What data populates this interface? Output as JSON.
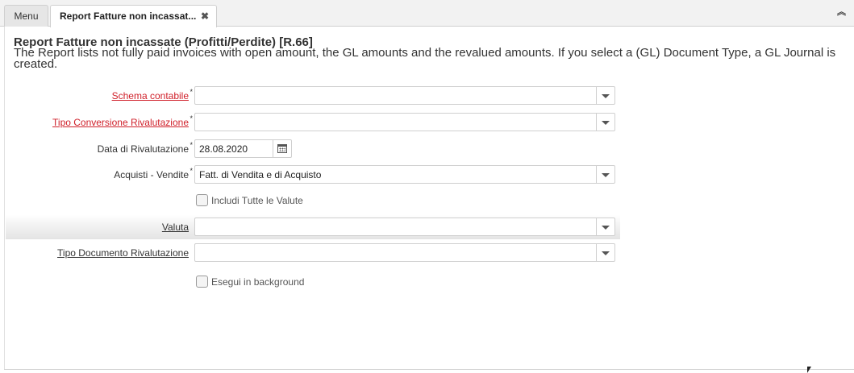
{
  "tabs": {
    "menu_label": "Menu",
    "active_label": "Report Fatture non incassat...",
    "close_glyph": "✖",
    "collapse_glyph": "⌃"
  },
  "report": {
    "title": "Report Fatture non incassate (Profitti/Perdite) [R.66]",
    "description": "The Report lists not fully paid invoices with open amount, the GL amounts and the revalued amounts. If you select a (GL) Document Type, a GL Journal is created."
  },
  "fields": {
    "schema": {
      "label": "Schema contabile",
      "required_mark": "*",
      "value": ""
    },
    "tipo_conversione": {
      "label": "Tipo Conversione Rivalutazione",
      "required_mark": "*",
      "value": ""
    },
    "data": {
      "label": "Data di Rivalutazione",
      "required_mark": "*",
      "value": "28.08.2020"
    },
    "acquisti": {
      "label": "Acquisti - Vendite",
      "required_mark": "*",
      "value": "Fatt. di Vendita e di Acquisto"
    },
    "includi": {
      "label": "Includi Tutte le Valute"
    },
    "valuta": {
      "label": "Valuta",
      "value": ""
    },
    "tipo_documento": {
      "label": "Tipo Documento Rivalutazione",
      "value": ""
    },
    "esegui": {
      "label": "Esegui in background"
    }
  },
  "icons": {
    "dropdown": "chevron-down-icon",
    "calendar": "calendar-icon"
  }
}
